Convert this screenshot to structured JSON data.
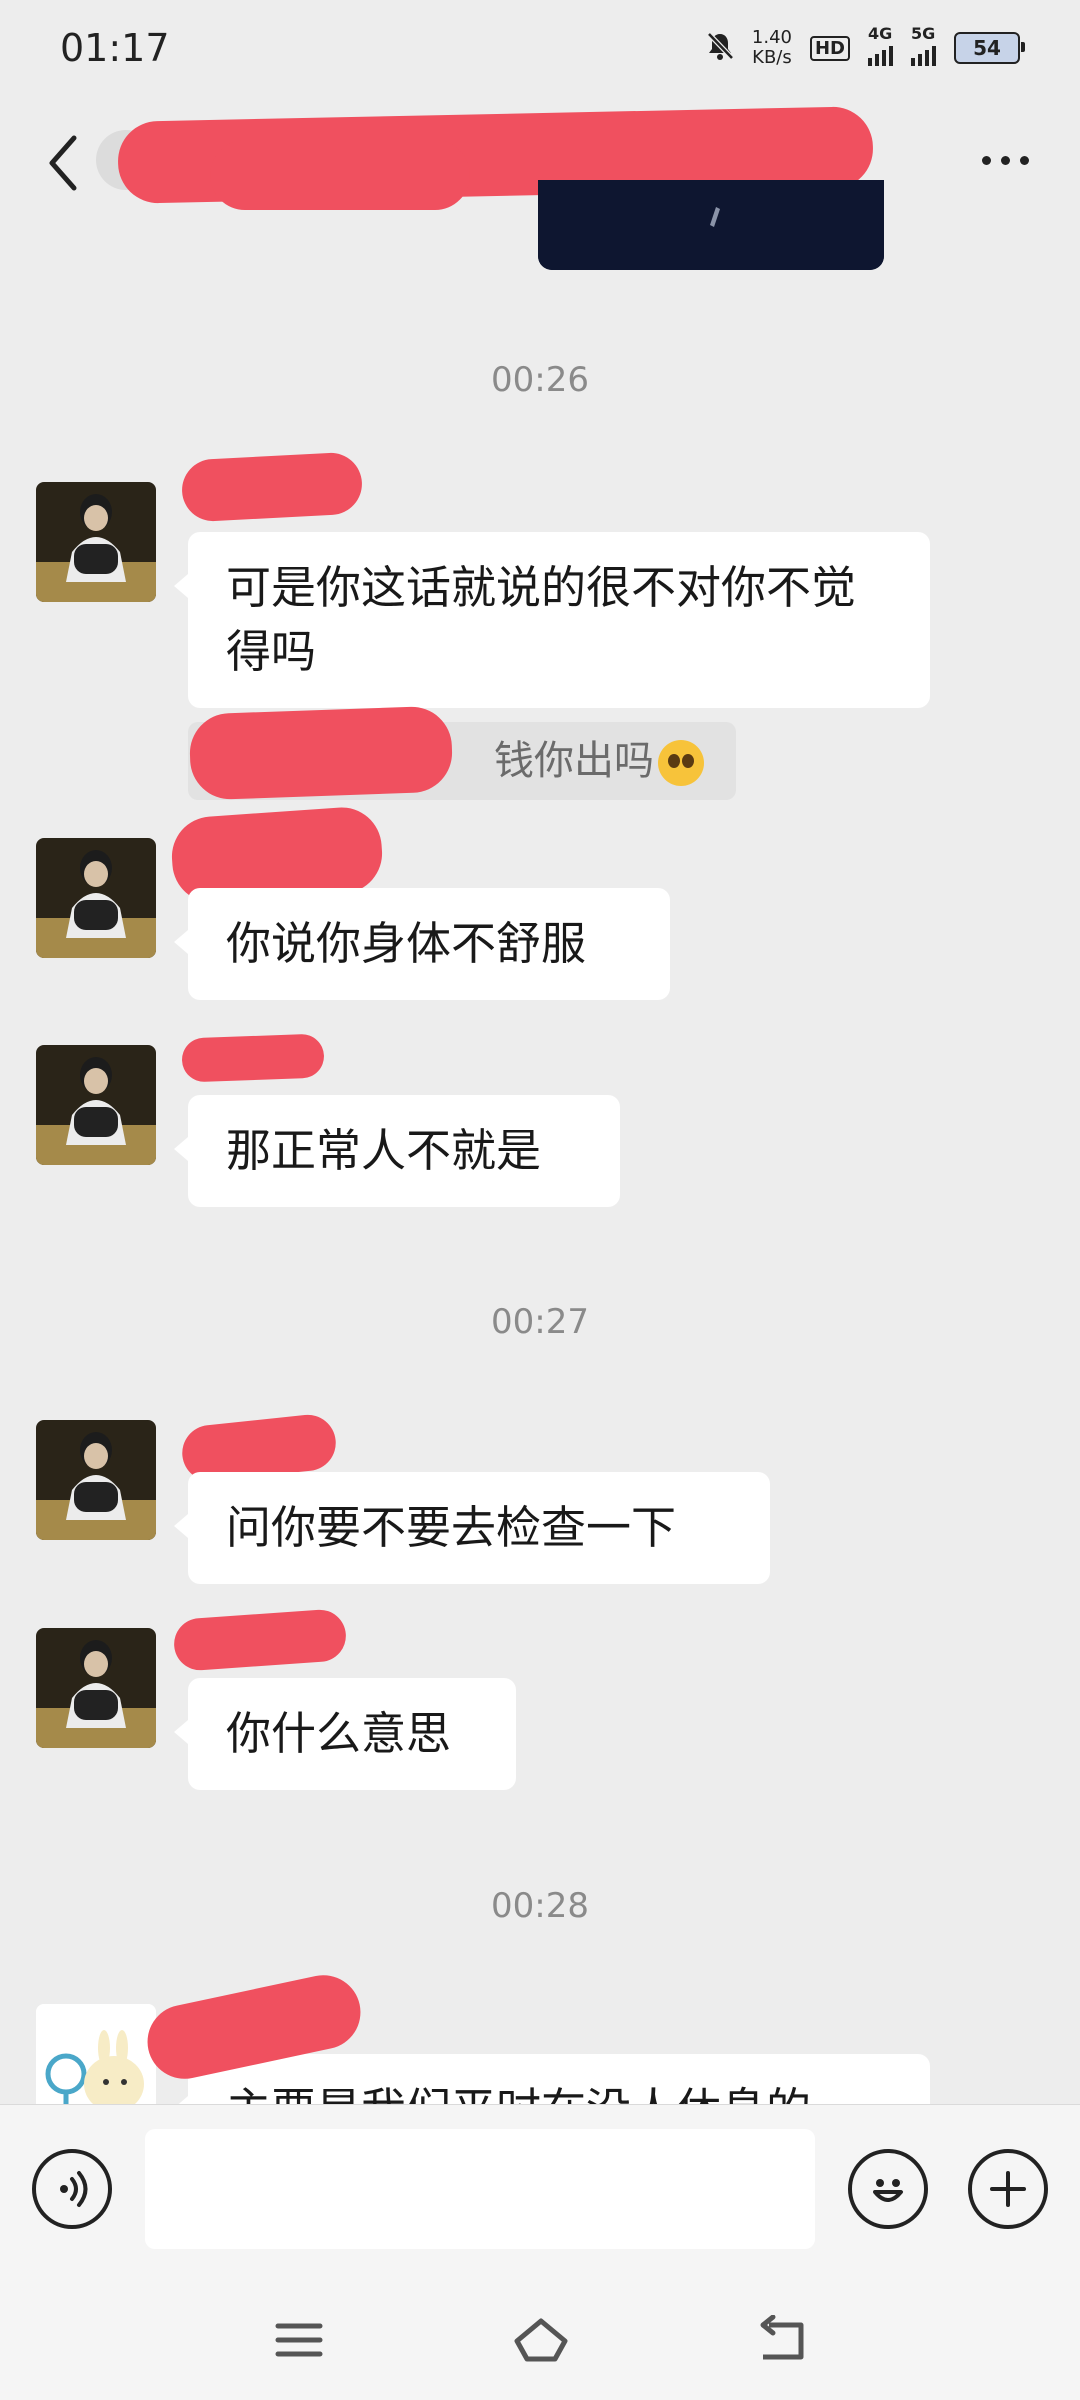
{
  "status_bar": {
    "time": "01:17",
    "net_speed_value": "1.40",
    "net_speed_unit": "KB/s",
    "hd_badge": "HD",
    "sim1_label": "4G",
    "sim2_label": "5G",
    "battery": "54"
  },
  "header": {
    "back_icon": "chevron-left-icon",
    "more_icon": "more-dots-icon"
  },
  "messages": [
    {
      "type": "timestamp",
      "text": "00:26"
    },
    {
      "type": "received",
      "text": "可是你这话就说的很不对你不觉得吗"
    },
    {
      "type": "quote",
      "text": "钱你出吗",
      "emoji": "pleading-face-emoji"
    },
    {
      "type": "received",
      "text": "你说你身体不舒服"
    },
    {
      "type": "received",
      "text": "那正常人不就是"
    },
    {
      "type": "timestamp",
      "text": "00:27"
    },
    {
      "type": "received",
      "text": "问你要不要去检查一下"
    },
    {
      "type": "received",
      "text": "你什么意思"
    },
    {
      "type": "timestamp",
      "text": "00:28"
    },
    {
      "type": "received",
      "text": "主要是我们平时在没人休息的"
    }
  ],
  "input_bar": {
    "voice_icon": "voice-icon",
    "emoji_icon": "emoji-icon",
    "plus_icon": "plus-icon",
    "text_value": ""
  },
  "nav_bar": {
    "menu_icon": "menu-icon",
    "home_icon": "home-icon",
    "back_icon": "back-arrow-icon"
  },
  "colors": {
    "background": "#ededed",
    "bubble": "#ffffff",
    "redaction": "#f0505f"
  }
}
